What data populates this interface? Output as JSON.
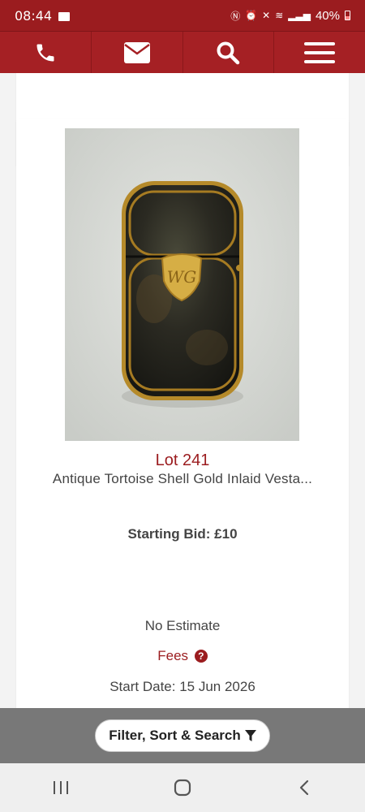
{
  "status_bar": {
    "time": "08:44",
    "battery": "40%"
  },
  "nav": {
    "items": [
      {
        "icon": "phone-icon"
      },
      {
        "icon": "envelope-icon"
      },
      {
        "icon": "search-icon"
      },
      {
        "icon": "menu-icon"
      }
    ]
  },
  "lot": {
    "number_label": "Lot 241",
    "title": "Antique Tortoise Shell Gold Inlaid Vesta...",
    "starting_bid": "Starting Bid: £10",
    "estimate": "No Estimate",
    "fees_label": "Fees",
    "start_date": "Start Date: 15 Jun 2026",
    "image_icon": "vesta-case-photo"
  },
  "filter": {
    "label": "Filter, Sort & Search",
    "icon": "filter-icon"
  },
  "android_nav": {
    "items": [
      "recent-apps-icon",
      "home-icon",
      "back-icon"
    ]
  },
  "colors": {
    "brand": "#9b1c1f",
    "nav_bg": "#a52024"
  }
}
